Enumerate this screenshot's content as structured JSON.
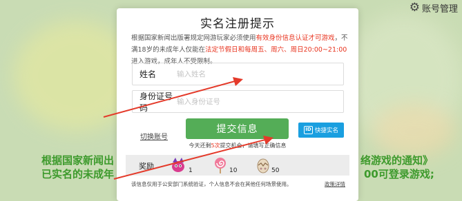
{
  "account_management": {
    "icon": "gear-icon",
    "label": "账号管理"
  },
  "background": {
    "notice_line1_left": "根据国家新闻出",
    "notice_line1_right": "络游戏的通知》",
    "notice_line2_left": "已实名的未成年",
    "notice_line2_right": "00可登录游戏;"
  },
  "dialog": {
    "title": "实名注册提示",
    "notice": {
      "part1": "根据国家新闻出版署规定网游玩家必须使用",
      "part2_red": "有效身份信息认证才可游戏",
      "part3": "，不满18岁的未成年人仅能在",
      "part4_red": "法定节假日和每周五、周六、周日20:00~21:00",
      "part5": "进入游戏，成年人不受限制。"
    },
    "name_field": {
      "label": "姓名",
      "placeholder": "输入姓名"
    },
    "id_field": {
      "label": "身份证号码",
      "placeholder": "输入身份证号"
    },
    "switch_account": "切换账号",
    "submit_label": "提交信息",
    "quick_button": {
      "icon": "id-card-icon",
      "label": "快捷实名"
    },
    "submit_hint": {
      "before": "今天还剩",
      "count": "5次",
      "after": "提交机会，请填写正确信息"
    },
    "rewards": {
      "label": "奖励",
      "items": [
        {
          "icon": "pink-creature-icon",
          "count": "1"
        },
        {
          "icon": "lollipop-icon",
          "count": "10"
        },
        {
          "icon": "egg-icon",
          "count": "50"
        }
      ]
    },
    "footer_text": "该信息仅用于公安部门系统验证，个人信息不会在其他任何场景使用。",
    "policy_link": "政策详情"
  },
  "colors": {
    "accent_red": "#e8331e",
    "submit_green": "#54ad57",
    "quick_blue": "#1a9fe0",
    "background_text_green": "#3d9a2c"
  }
}
